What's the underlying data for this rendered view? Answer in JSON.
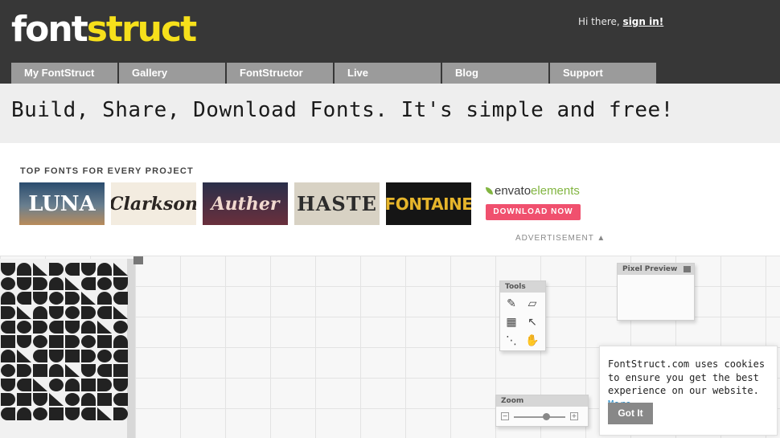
{
  "header": {
    "logo_part1": "font",
    "logo_part2": "struct",
    "greeting": "Hi there, ",
    "signin_link": "sign in!"
  },
  "nav": {
    "tabs": [
      {
        "label": "My FontStruct"
      },
      {
        "label": "Gallery"
      },
      {
        "label": "FontStructor"
      },
      {
        "label": "Live"
      },
      {
        "label": "Blog"
      },
      {
        "label": "Support"
      }
    ]
  },
  "banner": {
    "headline": "Build, Share, Download Fonts. It's simple and free!"
  },
  "ad": {
    "title": "TOP FONTS FOR EVERY PROJECT",
    "fonts": [
      "LUNA",
      "Clarkson",
      "Auther",
      "HASTE",
      "FONTAINE"
    ],
    "brand_prefix": "envato",
    "brand_suffix": "elements",
    "cta": "DOWNLOAD NOW",
    "label": "ADVERTISEMENT ▲"
  },
  "editor": {
    "tools_title": "Tools",
    "pixel_preview_title": "Pixel Preview",
    "zoom_title": "Zoom",
    "zoom_minus": "−",
    "zoom_plus": "+"
  },
  "cookie": {
    "message": "FontStruct.com uses cookies to ensure you get the best experience on our website. ",
    "more_link": "More",
    "button": "Got It"
  },
  "colors": {
    "header_bg": "#373737",
    "logo_accent": "#f6e01b",
    "nav_tab_bg": "#9b9b9b",
    "cta_pink": "#f0506e",
    "envato_green": "#82b541"
  }
}
